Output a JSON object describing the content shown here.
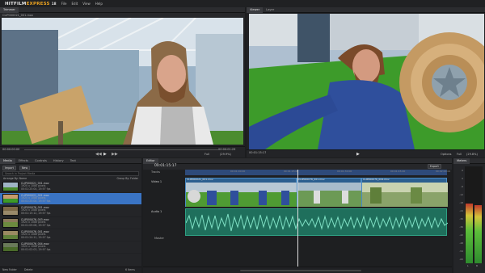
{
  "app": {
    "logo_a": "HITFILM",
    "logo_b": "EXPRESS",
    "version": "18"
  },
  "menu": [
    "File",
    "Edit",
    "View",
    "Help"
  ],
  "trimmer": {
    "tab": "Trimmer",
    "clip": "CLIP000021_001.mov",
    "tc_left": "00:00:00:00",
    "tc_right": "00:00:01:29",
    "zoom": "Full",
    "fit": "(29.9%)"
  },
  "viewer": {
    "tabs": [
      "Viewer",
      "Layer"
    ],
    "tc_left": "00:01:15:17",
    "options": "Options",
    "fullscreen": "Full",
    "fit": "(29.8%)"
  },
  "media": {
    "tabs": [
      "Media",
      "Effects",
      "Controls",
      "History",
      "Text"
    ],
    "import": "Import",
    "new": "New",
    "search_placeholder": "Search in Project Media",
    "arrange": "Arrange By: Name",
    "group": "Group By: Folder",
    "items": [
      {
        "name": "CLIP000021_001.mov",
        "l1": "1920 x 1080 pixels",
        "l2": "00:01:25:04, 29.97 fps"
      },
      {
        "name": "CLIP000021_001.mov",
        "l1": "1920 x 1080 pixels",
        "l2": "00:01:25:04, 29.97 fps"
      },
      {
        "name": "CLIP000076_001.mov",
        "l1": "1920 x 1080 pixels",
        "l2": "00:01:15:12, 29.97 fps"
      },
      {
        "name": "CLIP000076_003.mov",
        "l1": "1920 x 1080 pixels",
        "l2": "00:01:09:08, 29.97 fps"
      },
      {
        "name": "CLIP000076_001.mov",
        "l1": "1920 x 1080 pixels",
        "l2": "00:01:24:11, 29.97 fps"
      },
      {
        "name": "CLIP000076_004.mov",
        "l1": "1920 x 1080 pixels",
        "l2": "00:01:02:03, 29.97 fps"
      }
    ],
    "new_folder": "New Folder",
    "delete": "Delete",
    "count": "6 Items"
  },
  "editor": {
    "tab": "Editor",
    "timecode": "00:01:15:17",
    "export": "Export",
    "tracks_label": "Tracks",
    "video_track": "Video 1",
    "audio_track": "Audio 1",
    "master": "Master",
    "ruler": [
      "00:01:00:00",
      "00:01:15:00",
      "00:01:30:00",
      "00:01:45:00",
      "00:02:00:00"
    ],
    "clip_labels": [
      "CLIP000021_001.mov",
      "CLIP000076_001.mov",
      "CLIP000076_004.mov"
    ]
  },
  "meters": {
    "tab": "Meters",
    "scale": [
      "6",
      "0",
      "-6",
      "-12",
      "-18",
      "-24",
      "-30",
      "-36",
      "-42",
      "-48",
      "-54",
      "-60"
    ],
    "bottom": [
      "L",
      "R"
    ],
    "levels": [
      0.62,
      0.6
    ]
  }
}
